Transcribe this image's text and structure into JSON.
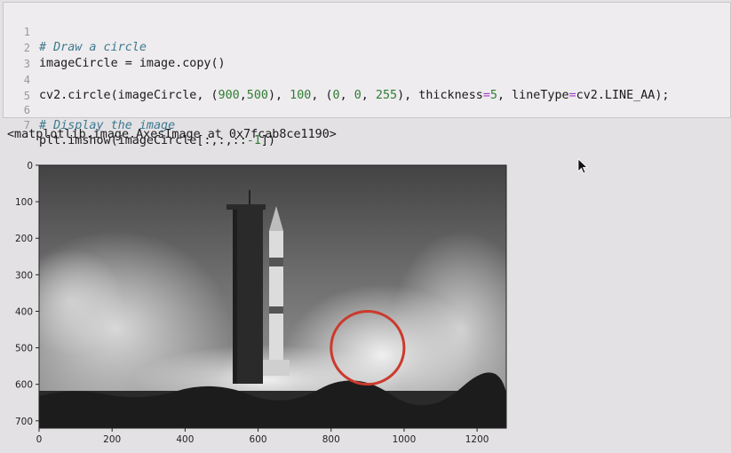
{
  "code_cell": {
    "lines": [
      {
        "n": "1",
        "comment": "# Draw a circle"
      },
      {
        "n": "2",
        "text": "imageCircle = image.copy()"
      },
      {
        "n": "3",
        "text": ""
      },
      {
        "n": "4",
        "a": "cv2.circle(imageCircle, (",
        "b": "900",
        "c": ",",
        "d": "500",
        "e": "), ",
        "f": "100",
        "g": ", (",
        "h": "0",
        "i": ", ",
        "j": "0",
        "k": ", ",
        "l": "255",
        "m": "), thickness",
        "eq1": "=",
        "o": "5",
        "p": ", lineType",
        "eq2": "=",
        "q": "cv2.LINE_AA);"
      },
      {
        "n": "5",
        "text": ""
      },
      {
        "n": "6",
        "comment": "# Display the image"
      },
      {
        "n": "7",
        "a": "plt.imshow(imageCircle[:,:,::",
        "b": "-1",
        "c": "])"
      }
    ]
  },
  "output_text": "<matplotlib.image.AxesImage at 0x7fcab8ce1190>",
  "plot": {
    "x_ticks": [
      "0",
      "200",
      "400",
      "600",
      "800",
      "1000",
      "1200"
    ],
    "y_ticks": [
      "0",
      "100",
      "200",
      "300",
      "400",
      "500",
      "600",
      "700"
    ],
    "xlim": [
      0,
      1280
    ],
    "ylim": [
      0,
      720
    ],
    "circle": {
      "cx": 900,
      "cy": 500,
      "r": 100,
      "color": "#cc3a2c"
    }
  },
  "colors": {
    "cell_bg": "#eeecee",
    "page_bg": "#e4e1e4",
    "comment": "#3d7a8f",
    "number": "#2f7d33"
  }
}
